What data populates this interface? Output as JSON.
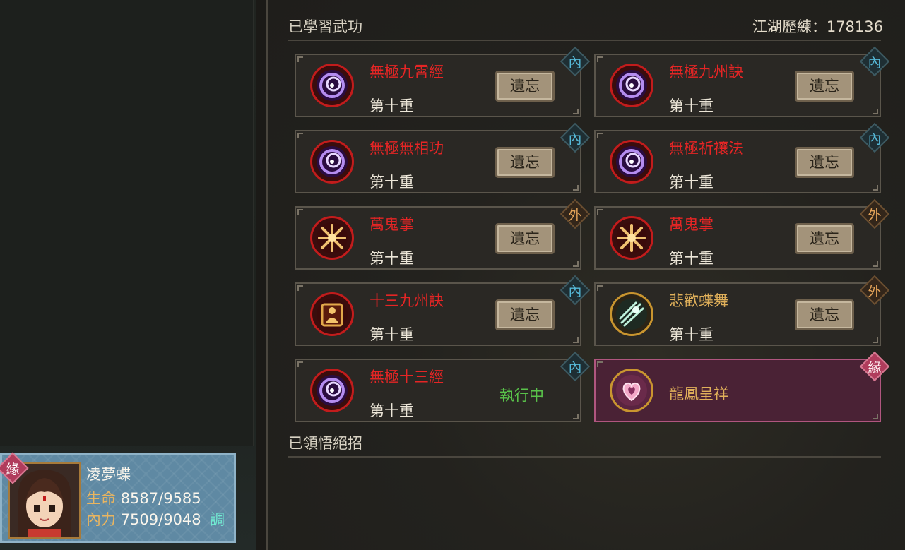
{
  "learned": {
    "title": "已學習武功",
    "exp_label": "江湖歷練",
    "exp_value": "178136"
  },
  "insight": {
    "title": "已領悟絕招"
  },
  "skills": [
    {
      "name": "無極九霄經",
      "level": "第十重",
      "action": "遺忘",
      "badge": "內",
      "type": "internal",
      "icon": "purple-vortex-icon"
    },
    {
      "name": "無極九州訣",
      "level": "第十重",
      "action": "遺忘",
      "badge": "內",
      "type": "internal",
      "icon": "purple-vortex-icon"
    },
    {
      "name": "無極無相功",
      "level": "第十重",
      "action": "遺忘",
      "badge": "內",
      "type": "internal",
      "icon": "purple-vortex-icon"
    },
    {
      "name": "無極祈禳法",
      "level": "第十重",
      "action": "遺忘",
      "badge": "內",
      "type": "internal",
      "icon": "purple-vortex-icon"
    },
    {
      "name": "萬鬼掌",
      "level": "第十重",
      "action": "遺忘",
      "badge": "外",
      "type": "external",
      "icon": "golden-burst-icon"
    },
    {
      "name": "萬鬼掌",
      "level": "第十重",
      "action": "遺忘",
      "badge": "外",
      "type": "external",
      "icon": "golden-burst-icon"
    },
    {
      "name": "十三九州訣",
      "level": "第十重",
      "action": "遺忘",
      "badge": "內",
      "type": "internal",
      "icon": "meditation-figure-icon"
    },
    {
      "name": "悲歡蝶舞",
      "level": "第十重",
      "action": "遺忘",
      "badge": "外",
      "type": "external",
      "icon": "jade-claw-icon"
    },
    {
      "name": "無極十三經",
      "level": "第十重",
      "status": "執行中",
      "badge": "內",
      "type": "internal",
      "icon": "purple-vortex-icon"
    },
    {
      "name": "龍鳳呈祥",
      "badge": "緣",
      "type": "destiny",
      "icon": "pink-heart-flame-icon"
    }
  ],
  "character": {
    "badge": "緣",
    "name": "凌夢蝶",
    "hp_label": "生命",
    "hp_value": "8587/9585",
    "mp_label": "內力",
    "mp_value": "7509/9048",
    "adjust": "調"
  },
  "colors": {
    "skill_red": "#e52525",
    "skill_gold": "#e0b05a",
    "running_green": "#59c24a",
    "internal_badge": "#56b9d8",
    "external_badge": "#e2a258",
    "destiny_bg": "#4a2235"
  }
}
